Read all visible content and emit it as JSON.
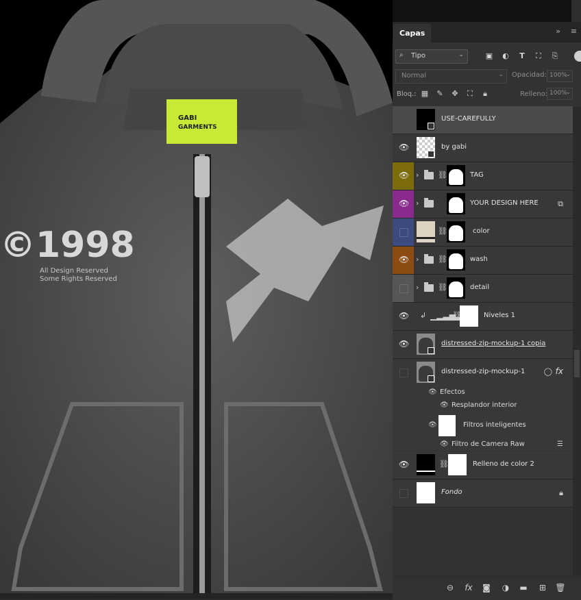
{
  "canvas": {
    "label_brand": "GABI GARMENTS",
    "print_year": "©1998",
    "print_sub1": "All Design Reserved",
    "print_sub2": "Some Rights Reserved"
  },
  "panel": {
    "tab_title": "Capas",
    "tab_more": "»",
    "filter_label": "Tipo",
    "blend_mode": "Normal",
    "opacity_label": "Opacidad:",
    "opacity_value": "100%",
    "lock_label": "Bloq.:",
    "fill_label": "Relleno:",
    "fill_value": "100%"
  },
  "layers": [
    {
      "name": "USE-CAREFULLY",
      "visible": false,
      "selected": true
    },
    {
      "name": "by gabi",
      "visible": true
    },
    {
      "name": "TAG",
      "visible": true,
      "color": "#7d6c0a"
    },
    {
      "name": "YOUR DESIGN HERE",
      "visible": true,
      "color": "#8a2a8c"
    },
    {
      "name": "color",
      "visible": false,
      "color": "#3c4a7e"
    },
    {
      "name": "wash",
      "visible": true,
      "color": "#8c4b10"
    },
    {
      "name": "detail",
      "visible": false,
      "color": "#565656"
    },
    {
      "name": "Niveles 1",
      "visible": true
    },
    {
      "name": "distressed-zip-mockup-1 copia",
      "visible": true
    },
    {
      "name": "distressed-zip-mockup-1",
      "visible": false
    },
    {
      "name": "Relleno de color 2",
      "visible": true
    },
    {
      "name": "Fondo",
      "visible": false
    }
  ],
  "effects": {
    "effects_label": "Efectos",
    "inner_glow": "Resplandor interior",
    "smart_filters": "Filtros inteligentes",
    "camera_raw": "Filtro de Camera Raw"
  },
  "icons": {
    "eye": "eye-icon",
    "folder": "folder-icon",
    "chain": "link-icon",
    "lock": "lock-icon",
    "fx": "fx-icon",
    "trash": "trash-icon"
  }
}
